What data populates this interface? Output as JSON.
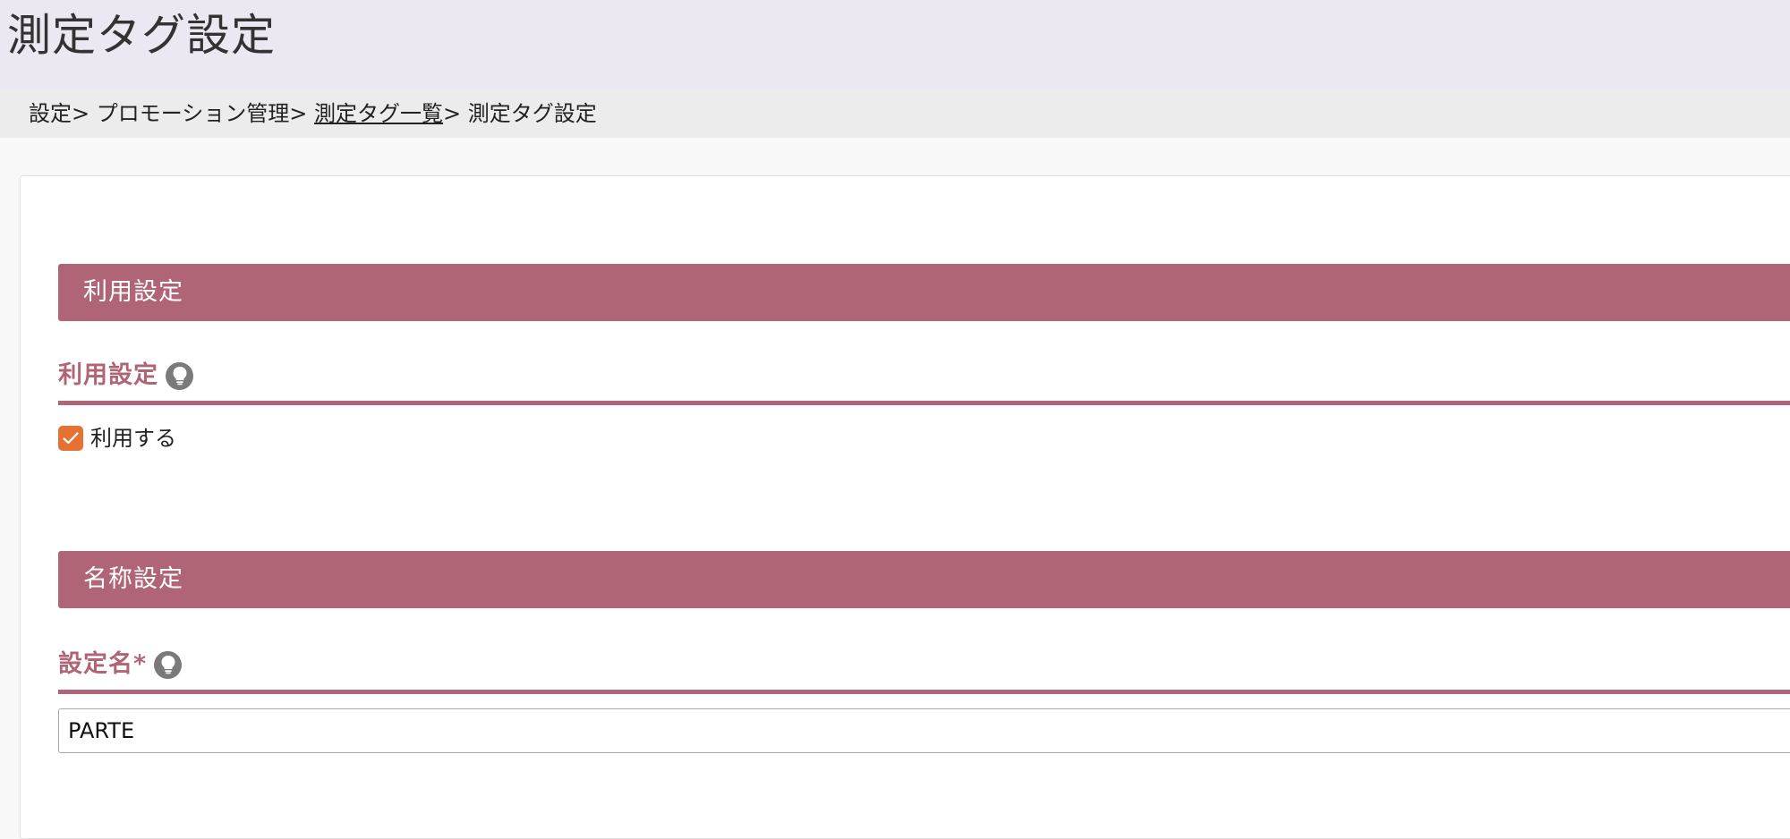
{
  "page": {
    "title": "測定タグ設定"
  },
  "breadcrumb": {
    "item1": "設定",
    "sep1": "> ",
    "item2": "プロモーション管理",
    "sep2": "> ",
    "item3_link": "測定タグ一覧",
    "sep3": "> ",
    "item4": "測定タグ設定"
  },
  "usage_section": {
    "header": "利用設定",
    "field_label": "利用設定",
    "checkbox": {
      "label": "利用する",
      "checked": true
    }
  },
  "name_section": {
    "header": "名称設定",
    "field_label": "設定名*",
    "input_value": "PARTE"
  },
  "icons": {
    "hint": "lightbulb-icon",
    "check": "check-icon"
  },
  "colors": {
    "accent": "#b06576",
    "checkbox": "#e57133",
    "title_bar_bg": "#ece8f2",
    "breadcrumb_bg": "#ececec"
  }
}
